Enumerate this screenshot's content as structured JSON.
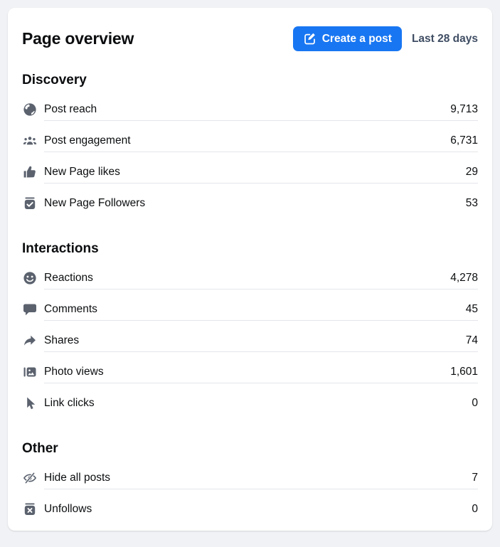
{
  "header": {
    "title": "Page overview",
    "create_post_label": "Create a post",
    "period_label": "Last 28 days"
  },
  "colors": {
    "accent": "#1876f2",
    "page_bg": "#f0f2f5",
    "card_bg": "#ffffff",
    "icon": "#5b626e",
    "divider": "#e4e6eb",
    "text": "#0b0d0f",
    "period": "#3f4d63"
  },
  "sections": [
    {
      "title": "Discovery",
      "rows": [
        {
          "icon": "globe-icon",
          "label": "Post reach",
          "value": "9,713"
        },
        {
          "icon": "people-icon",
          "label": "Post engagement",
          "value": "6,731"
        },
        {
          "icon": "thumbs-up-icon",
          "label": "New Page likes",
          "value": "29"
        },
        {
          "icon": "follower-check-icon",
          "label": "New Page Followers",
          "value": "53"
        }
      ]
    },
    {
      "title": "Interactions",
      "rows": [
        {
          "icon": "smiley-icon",
          "label": "Reactions",
          "value": "4,278"
        },
        {
          "icon": "comment-icon",
          "label": "Comments",
          "value": "45"
        },
        {
          "icon": "share-arrow-icon",
          "label": "Shares",
          "value": "74"
        },
        {
          "icon": "photo-icon",
          "label": "Photo views",
          "value": "1,601"
        },
        {
          "icon": "cursor-icon",
          "label": "Link clicks",
          "value": "0"
        }
      ]
    },
    {
      "title": "Other",
      "rows": [
        {
          "icon": "hidden-eye-icon",
          "label": "Hide all posts",
          "value": "7"
        },
        {
          "icon": "unfollow-icon",
          "label": "Unfollows",
          "value": "0"
        }
      ]
    }
  ]
}
